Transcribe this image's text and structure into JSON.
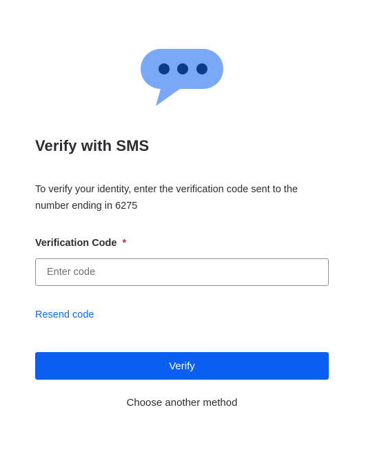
{
  "header": {
    "icon": "sms-chat-bubble-icon",
    "icon_color": "#7aa8f7",
    "dot_color": "#0b3b8c",
    "title": "Verify with SMS"
  },
  "main": {
    "description": "To verify your identity, enter the verification code sent to the number ending in 6275",
    "field": {
      "label": "Verification Code",
      "required_marker": "*",
      "placeholder": "Enter code",
      "value": ""
    },
    "resend_label": "Resend code",
    "verify_label": "Verify",
    "another_method_label": "Choose another method"
  },
  "colors": {
    "primary": "#0a5ef0",
    "link": "#0a6cf0",
    "required": "#d0213c"
  }
}
